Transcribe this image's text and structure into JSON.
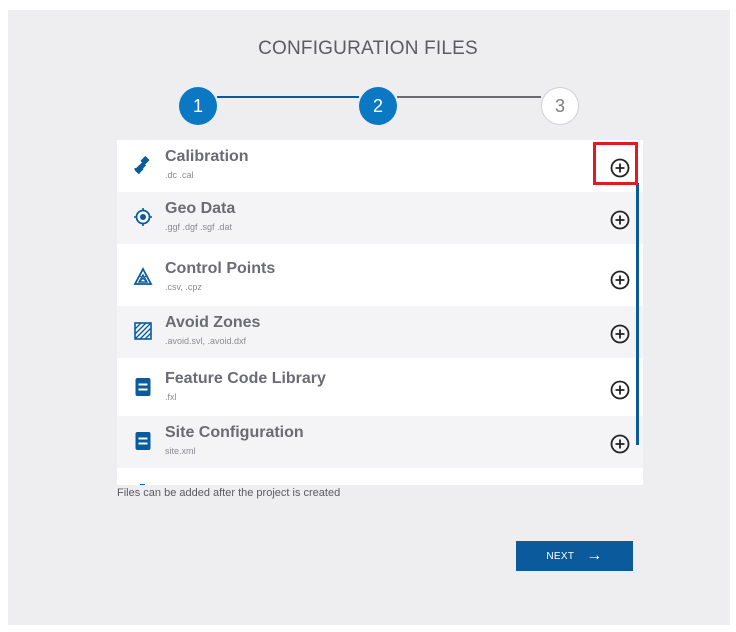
{
  "header": {
    "title": "CONFIGURATION FILES"
  },
  "stepper": {
    "steps": [
      {
        "label": "1",
        "state": "done"
      },
      {
        "label": "2",
        "state": "active"
      },
      {
        "label": "3",
        "state": "todo"
      }
    ]
  },
  "files": [
    {
      "name": "Calibration",
      "ext": ".dc .cal",
      "icon": "satellite-icon"
    },
    {
      "name": "Geo Data",
      "ext": ".ggf .dgf .sgf .dat",
      "icon": "target-icon"
    },
    {
      "name": "Control Points",
      "ext": ".csv, .cpz",
      "icon": "control-points-icon"
    },
    {
      "name": "Avoid Zones",
      "ext": ".avoid.svl, .avoid.dxf",
      "icon": "hatched-square-icon"
    },
    {
      "name": "Feature Code Library",
      "ext": ".fxl",
      "icon": "document-icon"
    },
    {
      "name": "Site Configuration",
      "ext": "site.xml",
      "icon": "document-icon"
    }
  ],
  "hint": "Files can be added after the project is created",
  "footer": {
    "next_label": "NEXT"
  },
  "colors": {
    "accent": "#0a78c2",
    "dark_accent": "#0a5a9c",
    "highlight": "#e11b22"
  }
}
